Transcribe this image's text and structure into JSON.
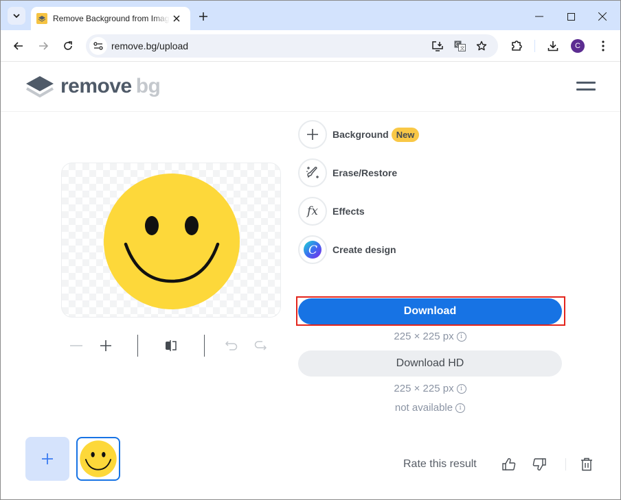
{
  "browser": {
    "tab": {
      "title": "Remove Background from Image for Free – remove.bg"
    },
    "address_bar": {
      "url": "remove.bg/upload"
    },
    "profile_initial": "C",
    "icons": [
      "tab-search-icon",
      "favicon",
      "close-icon",
      "new-tab-icon",
      "minimize-icon",
      "maximize-icon",
      "window-close-icon",
      "back-icon",
      "forward-icon",
      "reload-icon",
      "site-info-icon",
      "install-app-icon",
      "translate-icon",
      "bookmark-star-icon",
      "extensions-icon",
      "downloads-icon",
      "more-menu-icon"
    ]
  },
  "header": {
    "logo_word1": "remove",
    "logo_word2": "bg",
    "menu_icon": "hamburger-icon"
  },
  "actions": [
    {
      "label": "Background",
      "badge": "New",
      "icon": "plus-icon"
    },
    {
      "label": "Erase/Restore",
      "icon": "magic-brush-icon"
    },
    {
      "label": "Effects",
      "icon": "fx-icon"
    },
    {
      "label": "Create design",
      "icon": "canva-icon"
    }
  ],
  "download": {
    "label": "Download",
    "size": "225 × 225 px",
    "hd_label": "Download HD",
    "hd_size": "225 × 225 px",
    "hd_status": "not available"
  },
  "editor_tools": [
    "zoom-out-icon",
    "zoom-in-icon",
    "compare-icon",
    "undo-icon",
    "redo-icon"
  ],
  "footer": {
    "rate_label": "Rate this result",
    "icons": [
      "thumbs-up-icon",
      "thumbs-down-icon",
      "trash-icon"
    ]
  },
  "colors": {
    "accent_blue": "#1773e4",
    "badge_yellow": "#f9c846",
    "highlight_red": "#e3241b",
    "smiley_yellow": "#fdd83a"
  }
}
